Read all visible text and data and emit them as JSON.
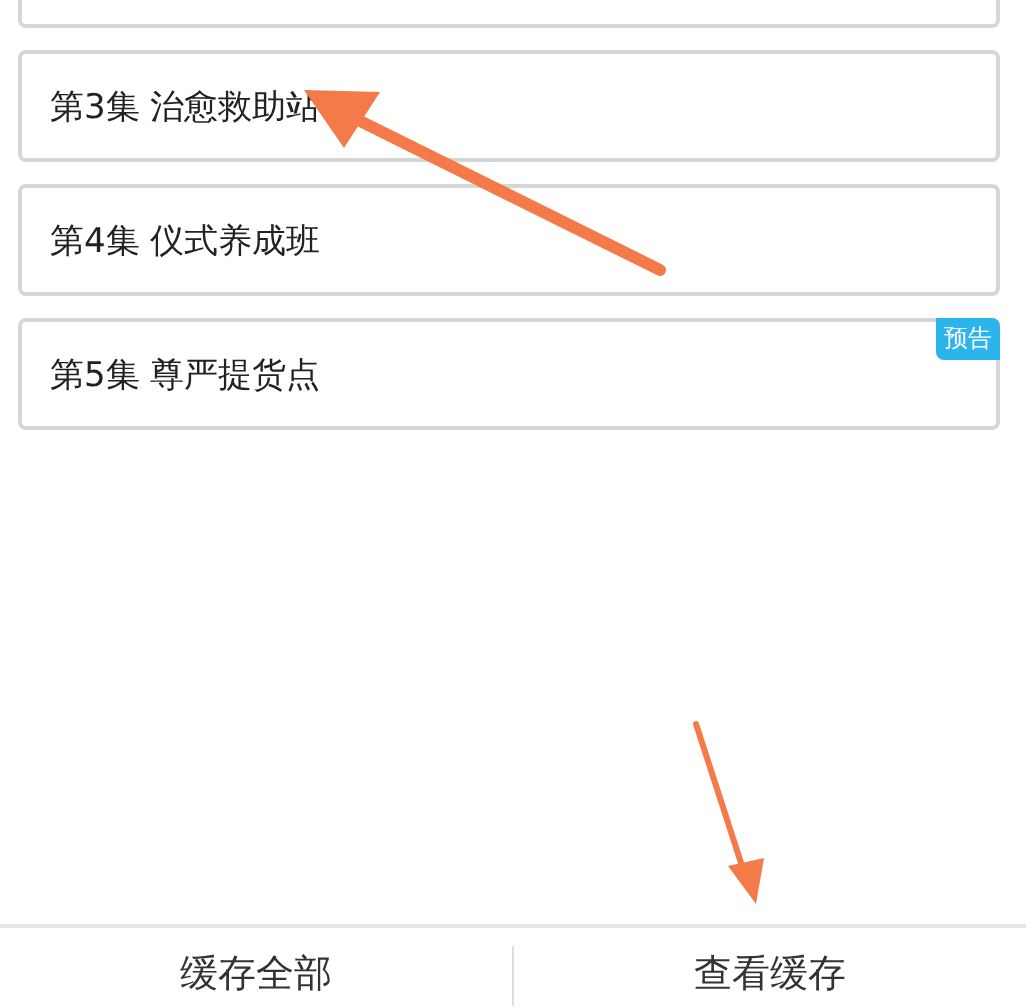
{
  "episodes": [
    {
      "title": "第3集 治愈救助站"
    },
    {
      "title": "第4集 仪式养成班"
    },
    {
      "title": "第5集 尊严提货点",
      "badge": "预告"
    }
  ],
  "bottom_bar": {
    "buttons": [
      "缓存全部",
      "查看缓存"
    ]
  }
}
